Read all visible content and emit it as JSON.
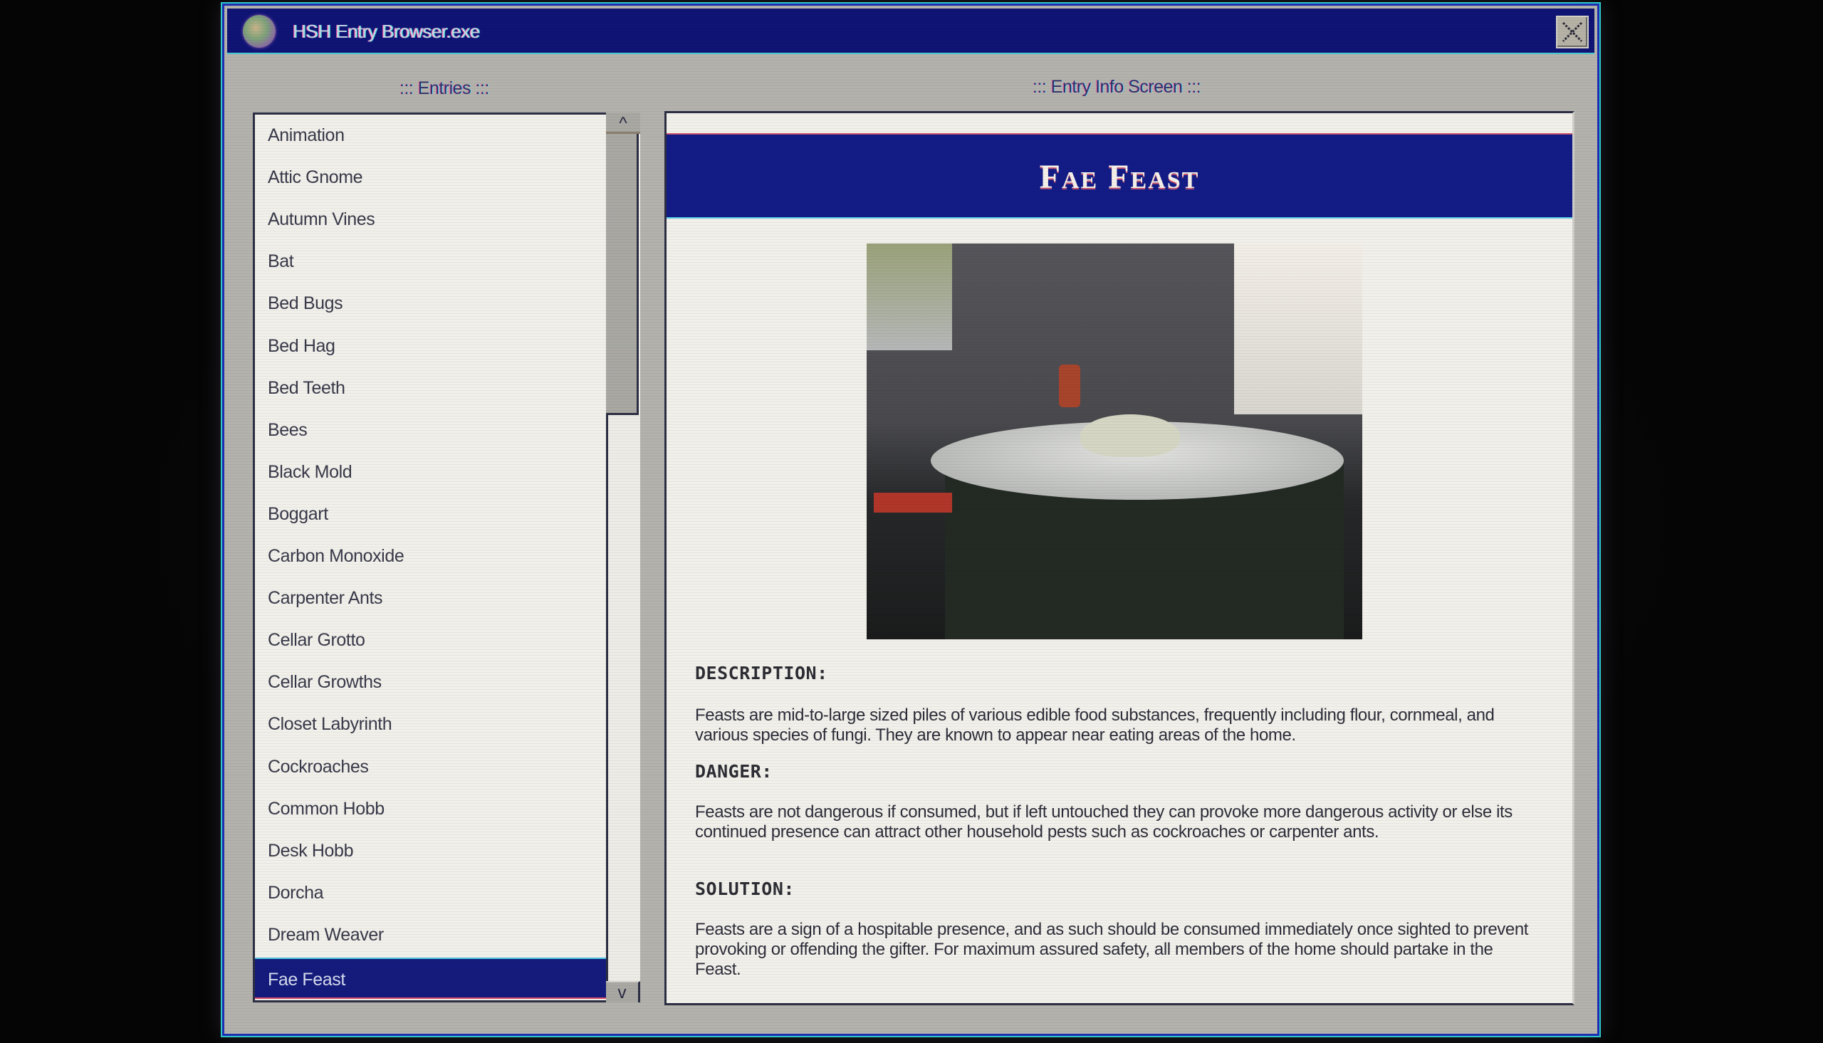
{
  "window": {
    "title": "HSH Entry Browser.exe",
    "app_icon": "globe-icon",
    "close_icon": "close-icon",
    "accent_color": "#131c86"
  },
  "entries_panel": {
    "label": "::: Entries :::",
    "items": [
      "Animation",
      "Attic Gnome",
      "Autumn Vines",
      "Bat",
      "Bed Bugs",
      "Bed Hag",
      "Bed Teeth",
      "Bees",
      "Black Mold",
      "Boggart",
      "Carbon Monoxide",
      "Carpenter Ants",
      "Cellar Grotto",
      "Cellar Growths",
      "Closet Labyrinth",
      "Cockroaches",
      "Common Hobb",
      "Desk Hobb",
      "Dorcha",
      "Dream Weaver",
      "Fae Feast"
    ],
    "selected": "Fae Feast",
    "scroll_up_label": "^",
    "scroll_down_label": "v"
  },
  "info_panel": {
    "label": "::: Entry Info Screen :::",
    "title": "Fae Feast",
    "image_alt": "Dining room with a round table holding a pile of food",
    "sections": {
      "description": {
        "heading": "DESCRIPTION:",
        "body": "Feasts are mid-to-large sized piles of various edible food substances, frequently including flour, cornmeal, and various species of fungi. They are known to appear near eating areas of the home."
      },
      "danger": {
        "heading": "DANGER:",
        "body": "Feasts are not dangerous if consumed, but if left untouched they can provoke more dangerous activity or else its continued presence can attract other household pests such as cockroaches or carpenter ants."
      },
      "solution": {
        "heading": "SOLUTION:",
        "body": "Feasts are a sign of a hospitable presence, and as such should be consumed immediately once sighted to prevent provoking or offending the gifter. For maximum assured safety, all members of the home should partake in the Feast."
      }
    }
  }
}
